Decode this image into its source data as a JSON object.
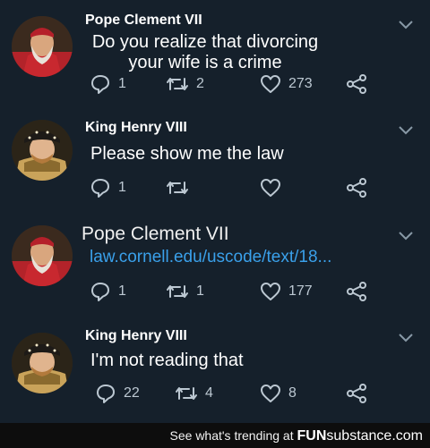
{
  "tweets": [
    {
      "author": "Pope Clement VII",
      "text": "Do you realize that divorcing\nyour wife is a crime",
      "replies": "1",
      "retweets": "2",
      "likes": "273"
    },
    {
      "author": "King Henry VIII",
      "text": "Please show me the law",
      "replies": "1",
      "retweets": "",
      "likes": ""
    },
    {
      "author": "Pope Clement VII",
      "text": "law.cornell.edu/uscode/text/18...",
      "replies": "1",
      "retweets": "1",
      "likes": "177"
    },
    {
      "author": "King Henry VIII",
      "text": "I'm not reading that",
      "replies": "22",
      "retweets": "4",
      "likes": "8"
    }
  ],
  "footer": {
    "text": "See what's trending at",
    "brand_fun": "FUN",
    "brand_sub": "substance",
    "brand_com": ".com"
  },
  "colors": {
    "background": "#15202b",
    "link": "#3aa0ea",
    "icon": "#bcc8d2"
  }
}
